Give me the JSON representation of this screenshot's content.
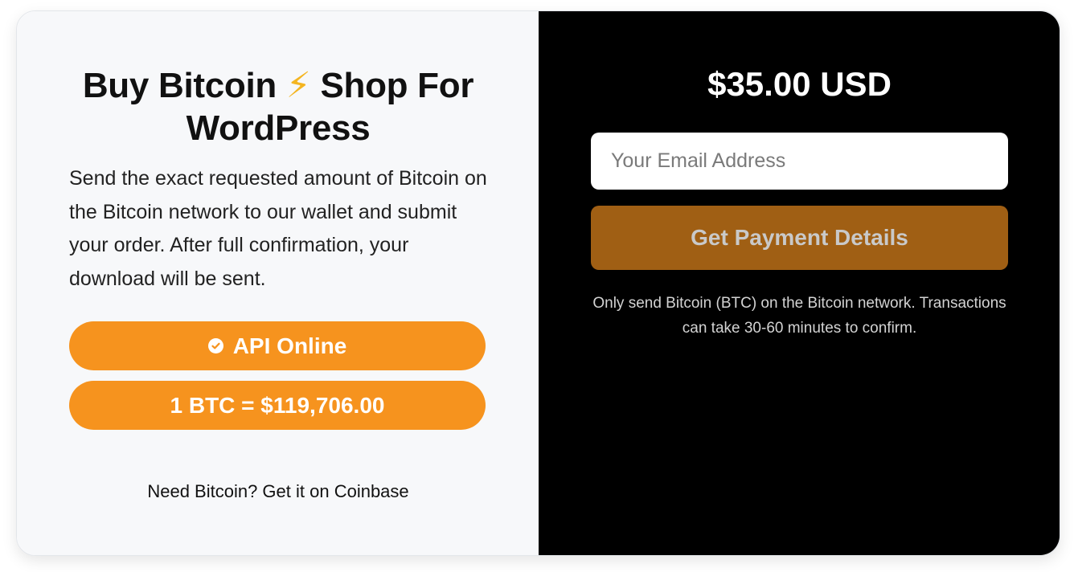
{
  "product": {
    "title_part1": "Buy Bitcoin",
    "title_icon": "⚡",
    "title_part2": "Shop For WordPress",
    "description": "Send the exact requested amount of Bitcoin on the Bitcoin network to our wallet and submit your order. After full confirmation, your download will be sent."
  },
  "status": {
    "api_label": "API Online",
    "rate_label": "1 BTC = $119,706.00"
  },
  "coinbase_link": "Need Bitcoin? Get it on Coinbase",
  "checkout": {
    "price": "$35.00 USD",
    "email_value": "",
    "email_placeholder": "Your Email Address",
    "submit_label": "Get Payment Details",
    "note": "Only send Bitcoin (BTC) on the Bitcoin network. Transactions can take 30-60 minutes to confirm."
  },
  "colors": {
    "accent": "#f6931e",
    "submit_button": "#a05f14",
    "left_panel": "#f7f8fa",
    "right_panel": "#000000"
  },
  "icons": {
    "title_icon": "lightning-bolt-icon",
    "api_icon": "check-circle-icon"
  }
}
